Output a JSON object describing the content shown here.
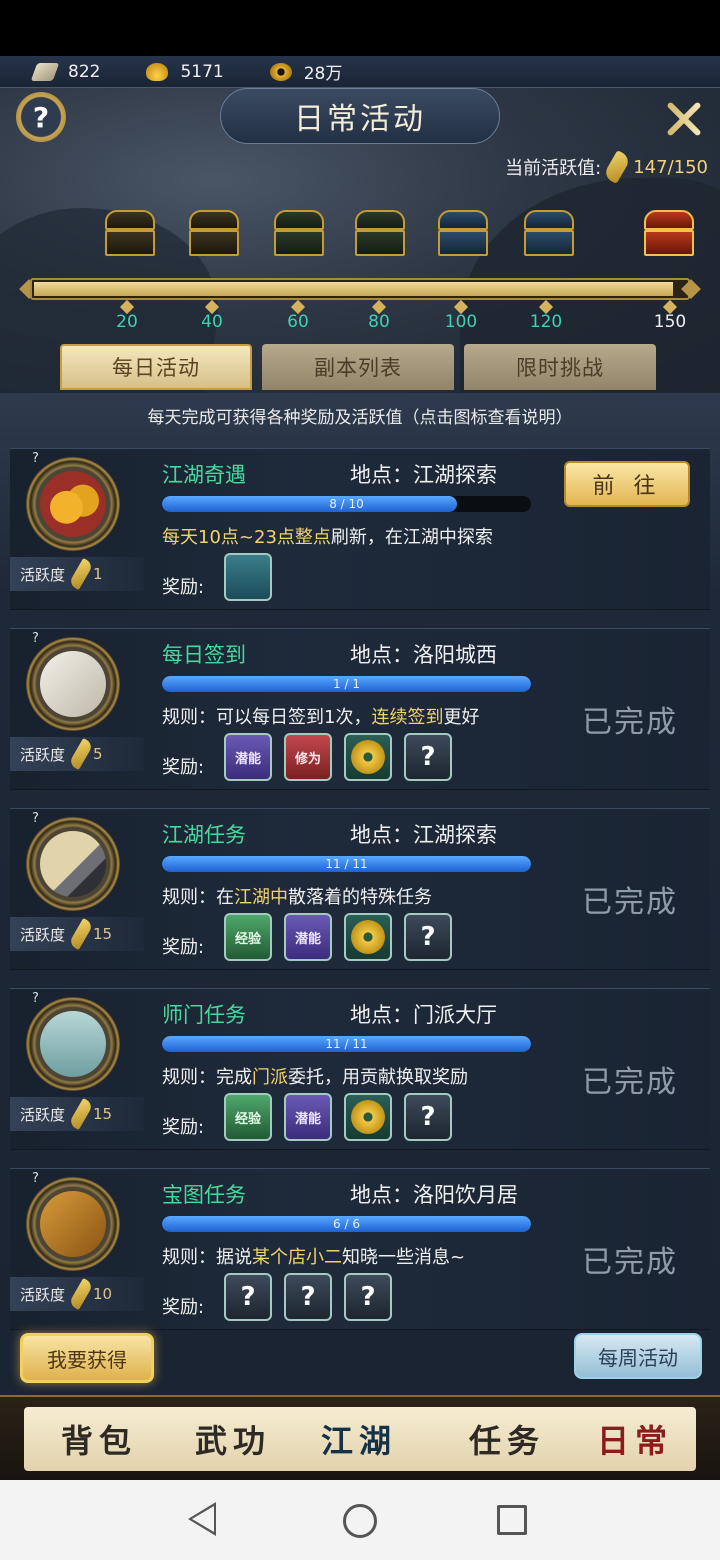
{
  "currency": [
    {
      "icon": "silver-scroll-icon",
      "value": "822"
    },
    {
      "icon": "gold-ingot-icon",
      "value": "5171"
    },
    {
      "icon": "copper-coin-icon",
      "value": "28万"
    }
  ],
  "header": {
    "title": "日常活动",
    "activity_label": "当前活跃值:",
    "activity_value": "147/150",
    "activity_current": 147,
    "activity_max": 150
  },
  "milestones": [
    "20",
    "40",
    "60",
    "80",
    "100",
    "120",
    "150"
  ],
  "tabs": [
    {
      "label": "每日活动",
      "active": true
    },
    {
      "label": "副本列表",
      "active": false
    },
    {
      "label": "限时挑战",
      "active": false
    }
  ],
  "subtitle": "每天完成可获得各种奖励及活跃值（点击图标查看说明）",
  "labels": {
    "activity": "活跃度",
    "rewards": "奖励:",
    "goto": "前 往",
    "done": "已完成",
    "qmark": "?"
  },
  "activities": [
    {
      "name": "江湖奇遇",
      "location": "地点：江湖探索",
      "progress_text": "8 / 10",
      "progress": 0.8,
      "rule_pre": "",
      "rule_hl": "每天10点~23点整点",
      "rule_post": "刷新，在江湖中探索",
      "activity_points": "1",
      "status": "goto",
      "rewards": [
        {
          "type": "jade-badge-icon",
          "text": ""
        }
      ]
    },
    {
      "name": "每日签到",
      "location": "地点：洛阳城西",
      "progress_text": "1 / 1",
      "progress": 1.0,
      "rule_pre": "规则：可以每日签到1次，",
      "rule_hl": "连续签到",
      "rule_post": "更好",
      "activity_points": "5",
      "status": "done",
      "rewards": [
        {
          "type": "purple-book-icon",
          "text": "潜能"
        },
        {
          "type": "red-book-icon",
          "text": "修为"
        },
        {
          "type": "coin-icon",
          "text": ""
        },
        {
          "type": "mystery-icon",
          "text": "?"
        }
      ]
    },
    {
      "name": "江湖任务",
      "location": "地点：江湖探索",
      "progress_text": "11 / 11",
      "progress": 1.0,
      "rule_pre": "规则：在",
      "rule_hl": "江湖中",
      "rule_post": "散落着的特殊任务",
      "activity_points": "15",
      "status": "done",
      "rewards": [
        {
          "type": "green-book-icon",
          "text": "经验"
        },
        {
          "type": "purple-book-icon",
          "text": "潜能"
        },
        {
          "type": "coin-icon",
          "text": ""
        },
        {
          "type": "mystery-icon",
          "text": "?"
        }
      ]
    },
    {
      "name": "师门任务",
      "location": "地点：门派大厅",
      "progress_text": "11 / 11",
      "progress": 1.0,
      "rule_pre": "规则：完成",
      "rule_hl": "门派",
      "rule_post": "委托，用贡献换取奖励",
      "activity_points": "15",
      "status": "done",
      "rewards": [
        {
          "type": "green-book-icon",
          "text": "经验"
        },
        {
          "type": "purple-book-icon",
          "text": "潜能"
        },
        {
          "type": "coin-icon",
          "text": ""
        },
        {
          "type": "mystery-icon",
          "text": "?"
        }
      ]
    },
    {
      "name": "宝图任务",
      "location": "地点：洛阳饮月居",
      "progress_text": "6 / 6",
      "progress": 1.0,
      "rule_pre": "规则：据说",
      "rule_hl": "某个店小二",
      "rule_post": "知晓一些消息~",
      "activity_points": "10",
      "status": "done",
      "rewards": [
        {
          "type": "mystery-icon",
          "text": "?"
        },
        {
          "type": "mystery-icon",
          "text": "?"
        },
        {
          "type": "mystery-icon",
          "text": "?"
        }
      ]
    }
  ],
  "buttons": {
    "get": "我要获得",
    "weekly": "每周活动"
  },
  "bottom_nav": [
    {
      "label": "背包",
      "active": false
    },
    {
      "label": "武功",
      "active": false
    },
    {
      "label": "江湖",
      "active": true
    },
    {
      "label": "任务",
      "active": false
    },
    {
      "label": "日常",
      "active": false
    }
  ]
}
